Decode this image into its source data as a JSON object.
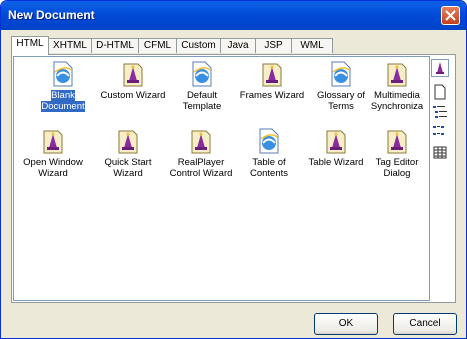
{
  "window": {
    "title": "New Document"
  },
  "tabs": [
    "HTML",
    "XHTML",
    "D-HTML",
    "CFML",
    "Custom",
    "Java",
    "JSP",
    "WML"
  ],
  "items": [
    {
      "label1": "Blank",
      "label2": "Document",
      "icon": "ie-document-icon"
    },
    {
      "label1": "Custom Wizard",
      "label2": "",
      "icon": "wizard-icon"
    },
    {
      "label1": "Default",
      "label2": "Template",
      "icon": "ie-document-icon"
    },
    {
      "label1": "Frames Wizard",
      "label2": "",
      "icon": "wizard-icon"
    },
    {
      "label1": "Glossary of",
      "label2": "Terms",
      "icon": "ie-document-icon"
    },
    {
      "label1": "Multimedia",
      "label2": "Synchroniza",
      "icon": "wizard-icon"
    },
    {
      "label1": "Open Window",
      "label2": "Wizard",
      "icon": "wizard-icon"
    },
    {
      "label1": "Quick Start",
      "label2": "Wizard",
      "icon": "wizard-icon"
    },
    {
      "label1": "RealPlayer",
      "label2": "Control Wizard",
      "icon": "wizard-icon"
    },
    {
      "label1": "Table of",
      "label2": "Contents",
      "icon": "ie-document-icon"
    },
    {
      "label1": "Table Wizard",
      "label2": "",
      "icon": "wizard-icon"
    },
    {
      "label1": "Tag Editor",
      "label2": "Dialog",
      "icon": "wizard-icon"
    }
  ],
  "buttons": {
    "ok": "OK",
    "cancel": "Cancel"
  },
  "view_buttons": [
    "large-icons-icon",
    "small-icons-icon",
    "list-view-icon",
    "details-view-icon"
  ]
}
